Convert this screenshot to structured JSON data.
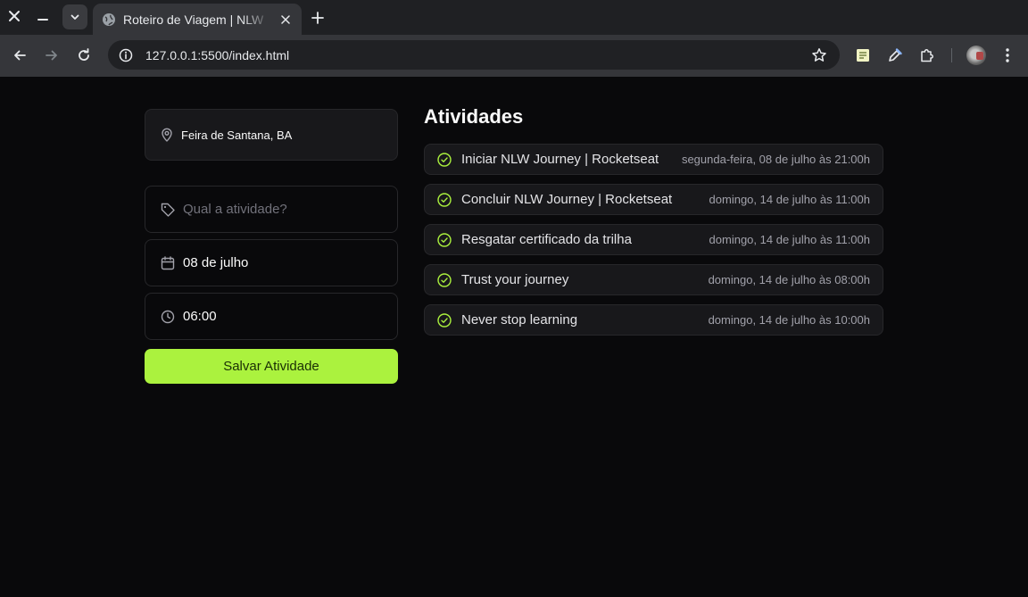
{
  "browser": {
    "tab_title": "Roteiro de Viagem | NLW",
    "url": "127.0.0.1:5500/index.html"
  },
  "location": {
    "text": "Feira de Santana, BA"
  },
  "form": {
    "activity_placeholder": "Qual a atividade?",
    "date_value": "08 de julho",
    "time_value": "06:00",
    "save_label": "Salvar Atividade"
  },
  "activities": {
    "title": "Atividades",
    "items": [
      {
        "name": "Iniciar NLW Journey | Rocketseat",
        "when": "segunda-feira, 08 de julho às 21:00h"
      },
      {
        "name": "Concluir NLW Journey | Rocketseat",
        "when": "domingo, 14 de julho às 11:00h"
      },
      {
        "name": "Resgatar certificado da trilha",
        "when": "domingo, 14 de julho às 11:00h"
      },
      {
        "name": "Trust your journey",
        "when": "domingo, 14 de julho às 08:00h"
      },
      {
        "name": "Never stop learning",
        "when": "domingo, 14 de julho às 10:00h"
      }
    ]
  },
  "colors": {
    "accent": "#abf23e",
    "background": "#09090b",
    "card": "#18181b",
    "border": "#27272a"
  },
  "icons": {
    "location": "map-pin-icon",
    "activity": "tag-icon",
    "date": "calendar-icon",
    "time": "clock-icon",
    "done": "circle-check-icon"
  }
}
